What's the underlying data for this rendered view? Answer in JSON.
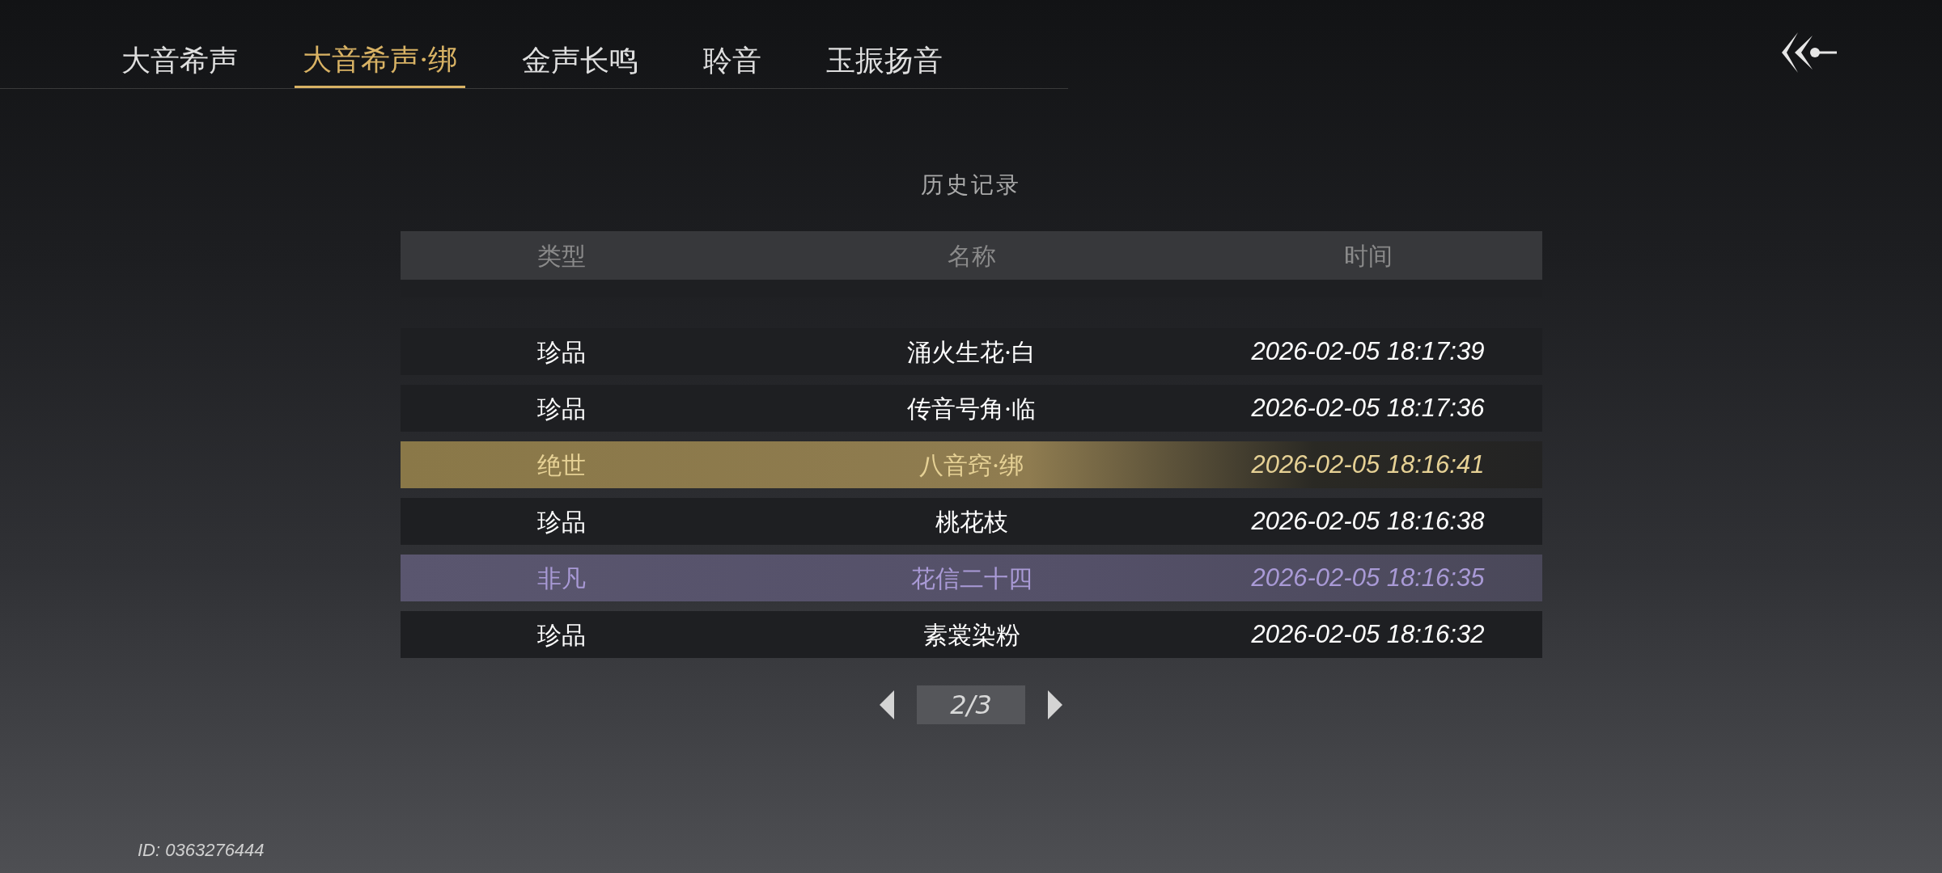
{
  "tabs": [
    {
      "label": "大音希声",
      "selected": false
    },
    {
      "label": "大音希声·绑",
      "selected": true
    },
    {
      "label": "金声长鸣",
      "selected": false
    },
    {
      "label": "聆音",
      "selected": false
    },
    {
      "label": "玉振扬音",
      "selected": false
    }
  ],
  "title": "历史记录",
  "table": {
    "columns": [
      "类型",
      "名称",
      "时间"
    ],
    "rows": [
      {
        "kind": "normal",
        "cells": [
          "珍品",
          "涌火生花·白",
          "2026-02-05 18:17:39"
        ]
      },
      {
        "kind": "normal",
        "cells": [
          "珍品",
          "传音号角·临",
          "2026-02-05 18:17:36"
        ]
      },
      {
        "kind": "legendary",
        "cells": [
          "绝世",
          "八音窍·绑",
          "2026-02-05 18:16:41"
        ]
      },
      {
        "kind": "normal",
        "cells": [
          "珍品",
          "桃花枝",
          "2026-02-05 18:16:38"
        ]
      },
      {
        "kind": "rare",
        "cells": [
          "非凡",
          "花信二十四",
          "2026-02-05 18:16:35"
        ]
      },
      {
        "kind": "normal",
        "cells": [
          "珍品",
          "素裳染粉",
          "2026-02-05 18:16:32"
        ]
      }
    ]
  },
  "pager": {
    "page": "2/3"
  },
  "player_id": "ID: 0363276444"
}
